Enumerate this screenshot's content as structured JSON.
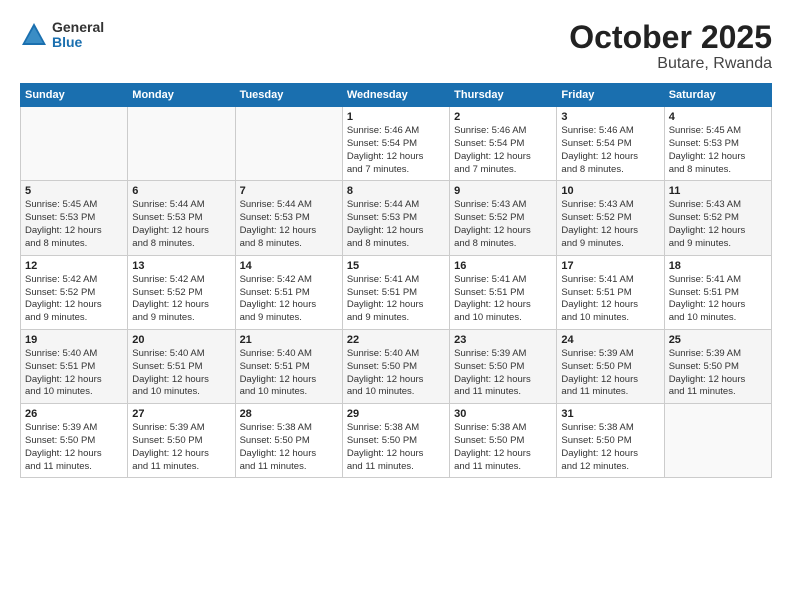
{
  "header": {
    "logo_general": "General",
    "logo_blue": "Blue",
    "title": "October 2025",
    "subtitle": "Butare, Rwanda"
  },
  "weekdays": [
    "Sunday",
    "Monday",
    "Tuesday",
    "Wednesday",
    "Thursday",
    "Friday",
    "Saturday"
  ],
  "weeks": [
    [
      {
        "day": "",
        "info": ""
      },
      {
        "day": "",
        "info": ""
      },
      {
        "day": "",
        "info": ""
      },
      {
        "day": "1",
        "info": "Sunrise: 5:46 AM\nSunset: 5:54 PM\nDaylight: 12 hours\nand 7 minutes."
      },
      {
        "day": "2",
        "info": "Sunrise: 5:46 AM\nSunset: 5:54 PM\nDaylight: 12 hours\nand 7 minutes."
      },
      {
        "day": "3",
        "info": "Sunrise: 5:46 AM\nSunset: 5:54 PM\nDaylight: 12 hours\nand 8 minutes."
      },
      {
        "day": "4",
        "info": "Sunrise: 5:45 AM\nSunset: 5:53 PM\nDaylight: 12 hours\nand 8 minutes."
      }
    ],
    [
      {
        "day": "5",
        "info": "Sunrise: 5:45 AM\nSunset: 5:53 PM\nDaylight: 12 hours\nand 8 minutes."
      },
      {
        "day": "6",
        "info": "Sunrise: 5:44 AM\nSunset: 5:53 PM\nDaylight: 12 hours\nand 8 minutes."
      },
      {
        "day": "7",
        "info": "Sunrise: 5:44 AM\nSunset: 5:53 PM\nDaylight: 12 hours\nand 8 minutes."
      },
      {
        "day": "8",
        "info": "Sunrise: 5:44 AM\nSunset: 5:53 PM\nDaylight: 12 hours\nand 8 minutes."
      },
      {
        "day": "9",
        "info": "Sunrise: 5:43 AM\nSunset: 5:52 PM\nDaylight: 12 hours\nand 8 minutes."
      },
      {
        "day": "10",
        "info": "Sunrise: 5:43 AM\nSunset: 5:52 PM\nDaylight: 12 hours\nand 9 minutes."
      },
      {
        "day": "11",
        "info": "Sunrise: 5:43 AM\nSunset: 5:52 PM\nDaylight: 12 hours\nand 9 minutes."
      }
    ],
    [
      {
        "day": "12",
        "info": "Sunrise: 5:42 AM\nSunset: 5:52 PM\nDaylight: 12 hours\nand 9 minutes."
      },
      {
        "day": "13",
        "info": "Sunrise: 5:42 AM\nSunset: 5:52 PM\nDaylight: 12 hours\nand 9 minutes."
      },
      {
        "day": "14",
        "info": "Sunrise: 5:42 AM\nSunset: 5:51 PM\nDaylight: 12 hours\nand 9 minutes."
      },
      {
        "day": "15",
        "info": "Sunrise: 5:41 AM\nSunset: 5:51 PM\nDaylight: 12 hours\nand 9 minutes."
      },
      {
        "day": "16",
        "info": "Sunrise: 5:41 AM\nSunset: 5:51 PM\nDaylight: 12 hours\nand 10 minutes."
      },
      {
        "day": "17",
        "info": "Sunrise: 5:41 AM\nSunset: 5:51 PM\nDaylight: 12 hours\nand 10 minutes."
      },
      {
        "day": "18",
        "info": "Sunrise: 5:41 AM\nSunset: 5:51 PM\nDaylight: 12 hours\nand 10 minutes."
      }
    ],
    [
      {
        "day": "19",
        "info": "Sunrise: 5:40 AM\nSunset: 5:51 PM\nDaylight: 12 hours\nand 10 minutes."
      },
      {
        "day": "20",
        "info": "Sunrise: 5:40 AM\nSunset: 5:51 PM\nDaylight: 12 hours\nand 10 minutes."
      },
      {
        "day": "21",
        "info": "Sunrise: 5:40 AM\nSunset: 5:51 PM\nDaylight: 12 hours\nand 10 minutes."
      },
      {
        "day": "22",
        "info": "Sunrise: 5:40 AM\nSunset: 5:50 PM\nDaylight: 12 hours\nand 10 minutes."
      },
      {
        "day": "23",
        "info": "Sunrise: 5:39 AM\nSunset: 5:50 PM\nDaylight: 12 hours\nand 11 minutes."
      },
      {
        "day": "24",
        "info": "Sunrise: 5:39 AM\nSunset: 5:50 PM\nDaylight: 12 hours\nand 11 minutes."
      },
      {
        "day": "25",
        "info": "Sunrise: 5:39 AM\nSunset: 5:50 PM\nDaylight: 12 hours\nand 11 minutes."
      }
    ],
    [
      {
        "day": "26",
        "info": "Sunrise: 5:39 AM\nSunset: 5:50 PM\nDaylight: 12 hours\nand 11 minutes."
      },
      {
        "day": "27",
        "info": "Sunrise: 5:39 AM\nSunset: 5:50 PM\nDaylight: 12 hours\nand 11 minutes."
      },
      {
        "day": "28",
        "info": "Sunrise: 5:38 AM\nSunset: 5:50 PM\nDaylight: 12 hours\nand 11 minutes."
      },
      {
        "day": "29",
        "info": "Sunrise: 5:38 AM\nSunset: 5:50 PM\nDaylight: 12 hours\nand 11 minutes."
      },
      {
        "day": "30",
        "info": "Sunrise: 5:38 AM\nSunset: 5:50 PM\nDaylight: 12 hours\nand 11 minutes."
      },
      {
        "day": "31",
        "info": "Sunrise: 5:38 AM\nSunset: 5:50 PM\nDaylight: 12 hours\nand 12 minutes."
      },
      {
        "day": "",
        "info": ""
      }
    ]
  ]
}
